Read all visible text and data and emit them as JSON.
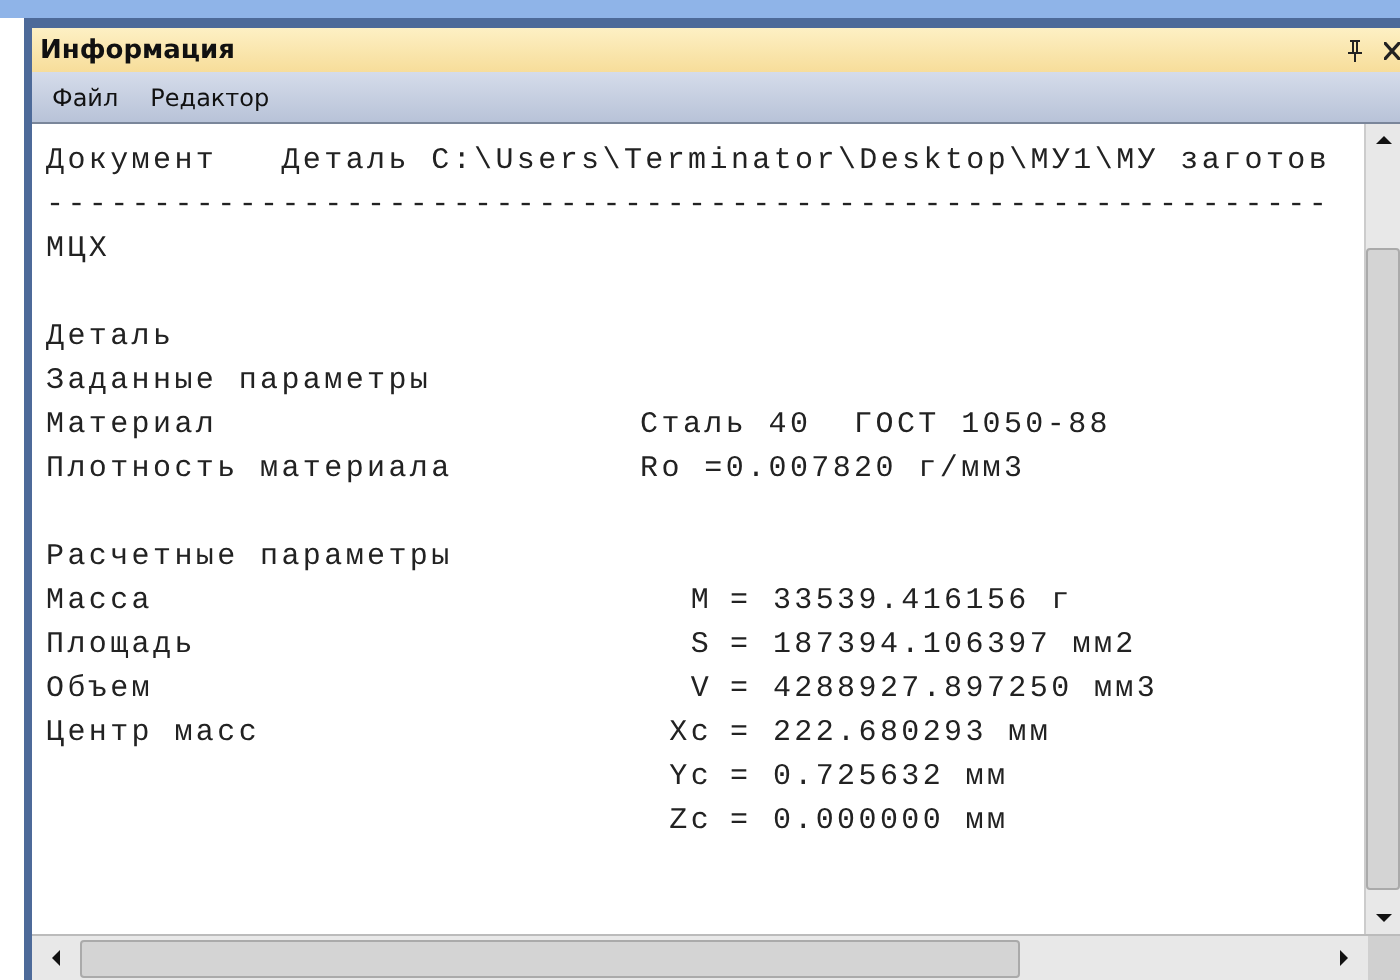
{
  "window": {
    "title": "Информация"
  },
  "menu": [
    "Файл",
    "Редактор"
  ],
  "document": {
    "header": "Документ   Деталь C:\\Users\\Terminator\\Desktop\\МУ1\\МУ заготов",
    "separator": "------------------------------------------------------------",
    "lines": [
      {
        "kind": "text",
        "text": "МЦХ"
      },
      {
        "kind": "blank"
      },
      {
        "kind": "text",
        "text": "Деталь"
      },
      {
        "kind": "text",
        "text": "Заданные параметры"
      },
      {
        "kind": "param",
        "label": "Материал",
        "value": "Сталь 40  ГОСТ 1050-88"
      },
      {
        "kind": "param",
        "label": "Плотность материала",
        "value": "Ro =0.007820 г/мм3"
      },
      {
        "kind": "blank"
      },
      {
        "kind": "text",
        "text": "Расчетные параметры"
      },
      {
        "kind": "result",
        "label": "Масса",
        "symbol": "M",
        "value": "= 33539.416156 г"
      },
      {
        "kind": "result",
        "label": "Площадь",
        "symbol": "S",
        "value": "= 187394.106397 мм2"
      },
      {
        "kind": "result",
        "label": "Объем",
        "symbol": "V",
        "value": "= 4288927.897250 мм3"
      },
      {
        "kind": "result",
        "label": "Центр масс",
        "symbol": "Xc",
        "value": "= 222.680293 мм"
      },
      {
        "kind": "result",
        "symbol": "Yc",
        "value": "= 0.725632 мм"
      },
      {
        "kind": "result",
        "symbol": "Zc",
        "value": "= 0.000000 мм"
      }
    ]
  }
}
